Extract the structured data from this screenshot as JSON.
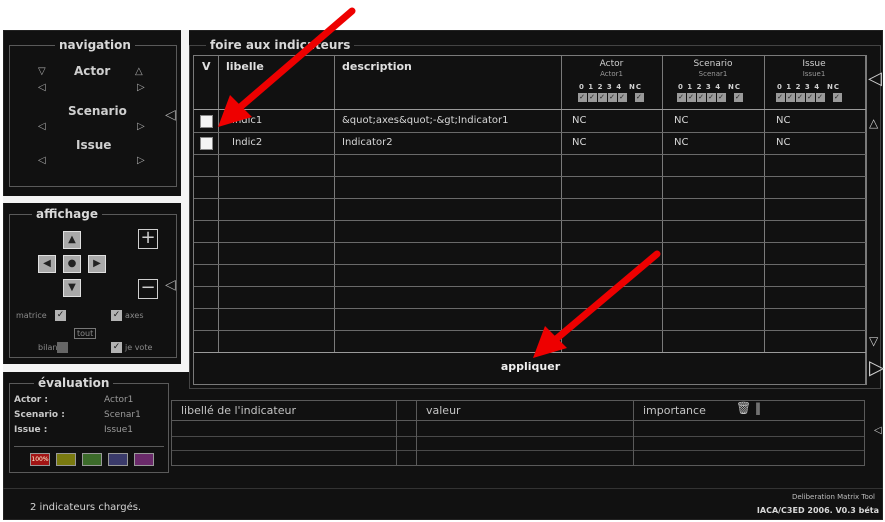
{
  "navigation": {
    "title": "navigation",
    "actor_label": "Actor",
    "scenario_label": "Scenario",
    "issue_label": "Issue"
  },
  "affichage": {
    "title": "affichage",
    "plus_label": "+",
    "minus_label": "−",
    "matrice_label": "matrice",
    "axes_label": "axes",
    "tout_label": "tout",
    "bilan_label": "bilan",
    "jevote_label": "je vote",
    "matrice_checked": true,
    "axes_checked": true,
    "jevote_checked": true
  },
  "faq": {
    "title": "foire aux indicateurs",
    "headers": {
      "v": "V",
      "libelle": "libelle",
      "description": "description"
    },
    "columns": [
      {
        "name": "Actor",
        "sub": "Actor1",
        "scale": "0 1 2 3 4",
        "nc": "NC"
      },
      {
        "name": "Scenario",
        "sub": "Scenar1",
        "scale": "0 1 2 3 4",
        "nc": "NC"
      },
      {
        "name": "Issue",
        "sub": "Issue1",
        "scale": "0 1 2 3 4",
        "nc": "NC"
      }
    ],
    "rows": [
      {
        "libelle": "Indic1",
        "description": "&quot;axes&quot;-&gt;Indicator1",
        "actor": "NC",
        "scenario": "NC",
        "issue": "NC",
        "checked": false
      },
      {
        "libelle": "Indic2",
        "description": "Indicator2",
        "actor": "NC",
        "scenario": "NC",
        "issue": "NC",
        "checked": false
      }
    ],
    "apply_label": "appliquer"
  },
  "evaluation": {
    "title": "évaluation",
    "actor_key": "Actor :",
    "actor_val": "Actor1",
    "scenario_key": "Scenario :",
    "scenario_val": "Scenar1",
    "issue_key": "Issue :",
    "issue_val": "Issue1",
    "color_scale": [
      {
        "label": "100%",
        "color": "#a31515"
      },
      {
        "label": "",
        "color": "#7a7a10"
      },
      {
        "label": "",
        "color": "#3c6b2a"
      },
      {
        "label": "",
        "color": "#3a3a6a"
      },
      {
        "label": "",
        "color": "#6a2a6a"
      }
    ]
  },
  "indicator_detail": {
    "libelle_header": "libellé de l'indicateur",
    "valeur_header": "valeur",
    "importance_header": "importance"
  },
  "status": {
    "message": "2 indicateurs chargés.",
    "app_name": "Deliberation Matrix Tool",
    "credits": "IACA/C3ED 2006. V0.3 béta"
  }
}
